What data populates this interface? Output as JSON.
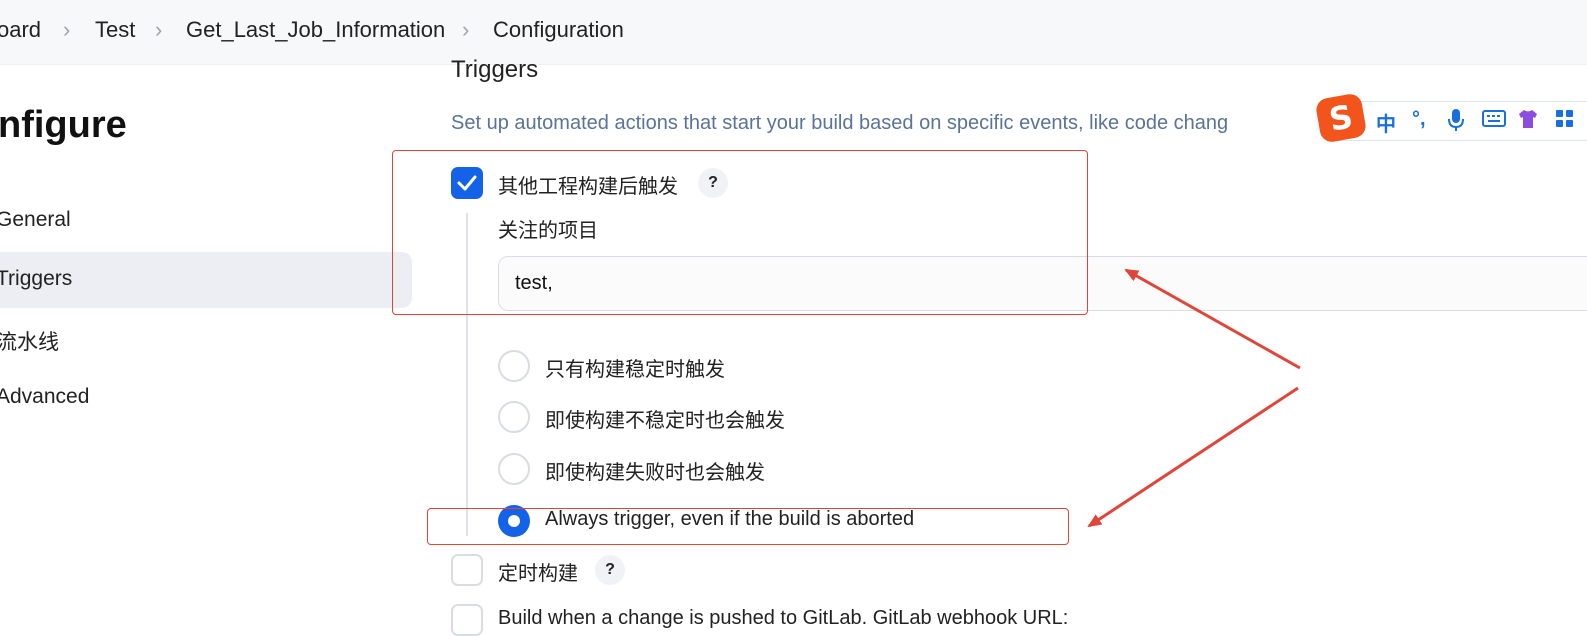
{
  "breadcrumb": {
    "items": [
      "oard",
      "Test",
      "Get_Last_Job_Information",
      "Configuration"
    ],
    "separator": ">"
  },
  "page": {
    "title": "nfigure"
  },
  "sidebar": {
    "items": [
      {
        "label": "General",
        "active": false
      },
      {
        "label": "Triggers",
        "active": true
      },
      {
        "label": "流水线",
        "active": false
      },
      {
        "label": "Advanced",
        "active": false
      }
    ]
  },
  "triggers": {
    "title": "Triggers",
    "description": "Set up automated actions that start your build based on specific events, like code chang",
    "after_other_projects": {
      "label": "其他工程构建后触发",
      "checked": true,
      "help": "?",
      "projects_label": "关注的项目",
      "projects_value": "test,",
      "options": [
        {
          "label": "只有构建稳定时触发",
          "selected": false
        },
        {
          "label": "即使构建不稳定时也会触发",
          "selected": false
        },
        {
          "label": "即使构建失败时也会触发",
          "selected": false
        },
        {
          "label": "Always trigger, even if the build is aborted",
          "selected": true
        }
      ]
    },
    "scheduled_build": {
      "label": "定时构建",
      "checked": false,
      "help": "?"
    },
    "gitlab_push": {
      "label": "Build when a change is pushed to GitLab. GitLab webhook URL:",
      "checked": false
    }
  },
  "ime_toolbar": {
    "logo": "S",
    "icons": [
      {
        "name": "chinese-mode-icon",
        "glyph": "中"
      },
      {
        "name": "punctuation-icon",
        "glyph": "°,"
      },
      {
        "name": "microphone-icon",
        "glyph": "🎤"
      },
      {
        "name": "keyboard-icon",
        "glyph": "⌨"
      },
      {
        "name": "skin-icon",
        "glyph": "👕"
      },
      {
        "name": "apps-icon",
        "glyph": "▦"
      }
    ]
  },
  "colors": {
    "accent": "#1462e8",
    "annotation": "#e0453a",
    "description_text": "#5a7398",
    "ime_brand": "#f2541b"
  }
}
